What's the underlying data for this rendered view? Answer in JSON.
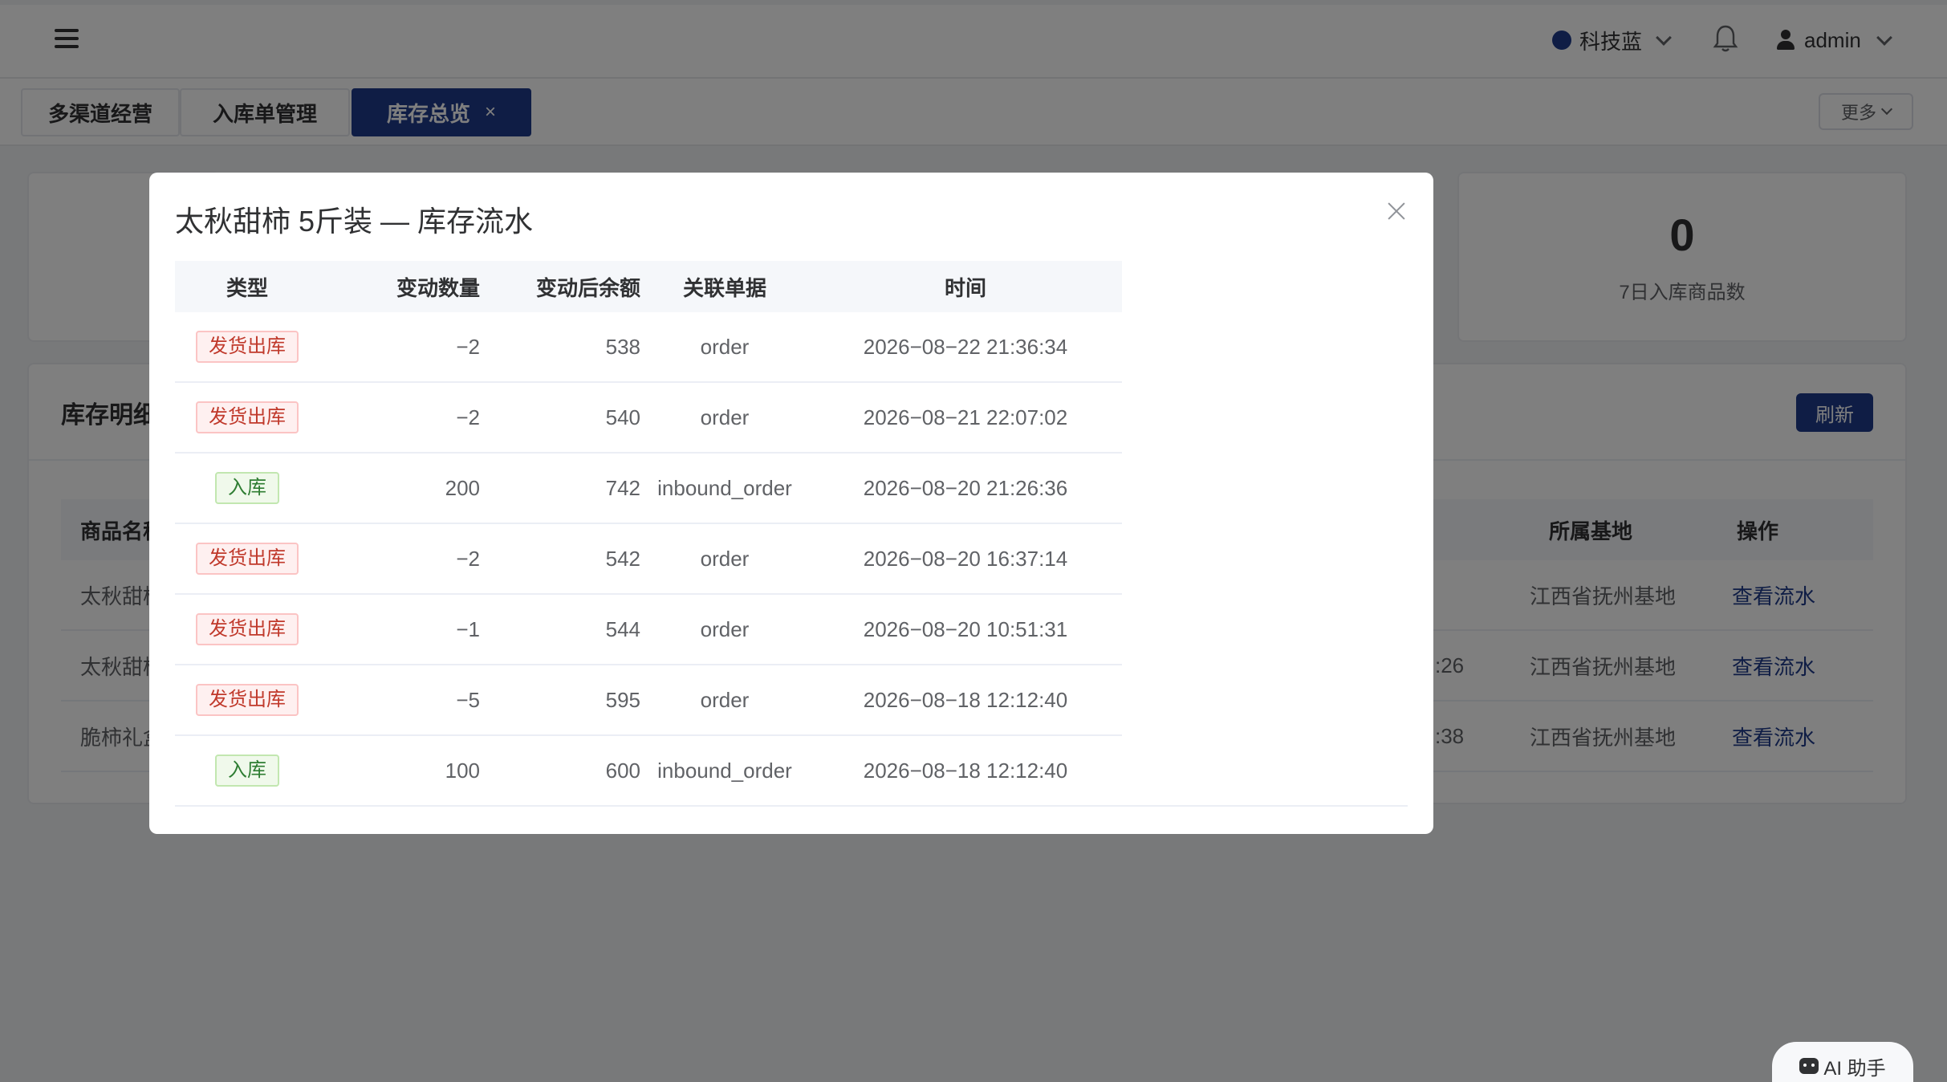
{
  "header": {
    "theme_label": "科技蓝",
    "user_name": "admin"
  },
  "tabs": [
    {
      "label": "多渠道经营"
    },
    {
      "label": "入库单管理"
    },
    {
      "label": "库存总览",
      "close": "×"
    }
  ],
  "more_label": "更多",
  "stat": {
    "value": "0",
    "label": "7日入库商品数"
  },
  "inventory_section": {
    "title": "库存明细",
    "refresh_label": "刷新",
    "columns": {
      "name": "商品名称",
      "base": "所属基地",
      "action": "操作"
    },
    "rows": [
      {
        "name": "太秋甜柿",
        "time_tail": "",
        "base": "江西省抚州基地",
        "action": "查看流水"
      },
      {
        "name": "太秋甜柿",
        "time_tail": ":26",
        "base": "江西省抚州基地",
        "action": "查看流水"
      },
      {
        "name": "脆柿礼盒",
        "time_tail": ":38",
        "base": "江西省抚州基地",
        "action": "查看流水"
      }
    ]
  },
  "ai_button": {
    "label": "AI 助手"
  },
  "dialog": {
    "title": "太秋甜柿 5斤装 — 库存流水",
    "columns": {
      "type": "类型",
      "qty": "变动数量",
      "balance": "变动后余额",
      "ref": "关联单据",
      "time": "时间"
    },
    "rows": [
      {
        "type": "发货出库",
        "kind": "out",
        "qty": "−2",
        "balance": "538",
        "ref": "order",
        "time": "2026−08−22 21:36:34"
      },
      {
        "type": "发货出库",
        "kind": "out",
        "qty": "−2",
        "balance": "540",
        "ref": "order",
        "time": "2026−08−21 22:07:02"
      },
      {
        "type": "入库",
        "kind": "in",
        "qty": "200",
        "balance": "742",
        "ref": "inbound_order",
        "time": "2026−08−20 21:26:36"
      },
      {
        "type": "发货出库",
        "kind": "out",
        "qty": "−2",
        "balance": "542",
        "ref": "order",
        "time": "2026−08−20 16:37:14"
      },
      {
        "type": "发货出库",
        "kind": "out",
        "qty": "−1",
        "balance": "544",
        "ref": "order",
        "time": "2026−08−20 10:51:31"
      },
      {
        "type": "发货出库",
        "kind": "out",
        "qty": "−5",
        "balance": "595",
        "ref": "order",
        "time": "2026−08−18 12:12:40"
      },
      {
        "type": "入库",
        "kind": "in",
        "qty": "100",
        "balance": "600",
        "ref": "inbound_order",
        "time": "2026−08−18 12:12:40"
      }
    ]
  },
  "colors": {
    "brand": "#1e3a8a",
    "out_tag": "#c0392b",
    "in_tag": "#2e7d32"
  }
}
